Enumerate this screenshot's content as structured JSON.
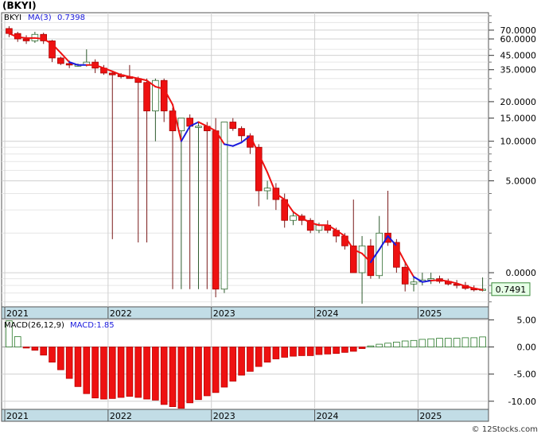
{
  "title": "(BKYI)",
  "watermark": "© 12Stocks.com",
  "colors": {
    "bullish": "#ffffff",
    "bearish": "#ee1111",
    "candle_outline": "#000000",
    "wick": "#7a1a1a",
    "ma_down": "#ee1111",
    "ma_up": "#1a1add",
    "axis_band": "#c2dde6",
    "grid": "#d0d0d0",
    "macd_pos": "#ffffff",
    "macd_pos_border": "#2a7a2a",
    "macd_neg": "#ee1111",
    "last_price_bg": "#e6ffe6",
    "last_price_border": "#3a8a3a"
  },
  "chart_data": [
    {
      "type": "candlestick",
      "title": "",
      "legend": {
        "ticker": "BKYI",
        "ma_label": "MA(3)",
        "ma_value": "0.7398",
        "placement": "top-left"
      },
      "y_scale": "log",
      "ylim": [
        0.55,
        95
      ],
      "y_ticks": [
        {
          "value": 70,
          "label": "70.0000"
        },
        {
          "value": 60,
          "label": "60.0000"
        },
        {
          "value": 45,
          "label": "45.0000"
        },
        {
          "value": 35,
          "label": "35.0000"
        },
        {
          "value": 20,
          "label": "20.0000"
        },
        {
          "value": 15,
          "label": "15.0000"
        },
        {
          "value": 10,
          "label": "10.0000"
        },
        {
          "value": 5,
          "label": "5.0000"
        },
        {
          "value": 1.0,
          "label": "0.0000"
        }
      ],
      "minor_grid": [
        90,
        80,
        50,
        40,
        30,
        25,
        9,
        8,
        7,
        6,
        4,
        3,
        2,
        0.9,
        0.8,
        0.7,
        0.6
      ],
      "last_price": {
        "value": 0.7491,
        "label": "0.7491"
      },
      "x_ticks": [
        {
          "index": 0,
          "label": "2021"
        },
        {
          "index": 12,
          "label": "2022"
        },
        {
          "index": 24,
          "label": "2023"
        },
        {
          "index": 36,
          "label": "2024"
        },
        {
          "index": 48,
          "label": "2025"
        }
      ],
      "candles": [
        [
          72,
          75,
          62,
          66
        ],
        [
          66,
          68,
          57,
          60
        ],
        [
          60,
          64,
          55,
          58
        ],
        [
          58,
          68,
          56,
          65
        ],
        [
          65,
          67,
          55,
          58
        ],
        [
          58,
          59,
          40,
          43
        ],
        [
          43,
          44,
          38,
          39
        ],
        [
          39,
          41,
          36,
          38
        ],
        [
          38,
          39,
          37,
          38
        ],
        [
          38,
          50,
          37,
          40
        ],
        [
          40,
          42,
          33,
          36
        ],
        [
          36,
          38,
          32,
          33
        ],
        [
          33,
          34,
          1.8,
          32
        ],
        [
          32,
          33,
          30,
          31
        ],
        [
          31,
          38,
          30,
          30
        ],
        [
          30,
          31,
          1.7,
          28
        ],
        [
          28,
          30,
          1.7,
          17
        ],
        [
          17,
          30,
          10,
          29
        ],
        [
          29,
          30,
          14,
          17
        ],
        [
          17,
          18,
          0.75,
          12
        ],
        [
          12,
          15,
          0.75,
          15
        ],
        [
          15,
          16,
          0.75,
          13
        ],
        [
          13,
          14,
          0.75,
          13
        ],
        [
          13,
          14,
          0.75,
          12
        ],
        [
          12,
          15,
          0.65,
          0.75
        ],
        [
          0.75,
          14,
          0.7,
          14
        ],
        [
          14,
          15,
          12,
          12.5
        ],
        [
          12.5,
          13,
          10,
          11
        ],
        [
          11,
          11.5,
          8,
          9
        ],
        [
          9,
          9.5,
          3.2,
          4.2
        ],
        [
          4.2,
          5,
          3.6,
          4.4
        ],
        [
          4.4,
          4.8,
          3,
          3.6
        ],
        [
          3.6,
          4,
          2.2,
          2.5
        ],
        [
          2.5,
          2.9,
          2.3,
          2.7
        ],
        [
          2.7,
          2.8,
          2.3,
          2.5
        ],
        [
          2.5,
          2.6,
          2.0,
          2.1
        ],
        [
          2.1,
          2.4,
          2.0,
          2.3
        ],
        [
          2.3,
          2.5,
          2.0,
          2.1
        ],
        [
          2.1,
          2.2,
          1.7,
          1.9
        ],
        [
          1.9,
          2.0,
          1.5,
          1.6
        ],
        [
          1.6,
          3.6,
          1.0,
          1.0
        ],
        [
          1.0,
          1.9,
          0.58,
          1.6
        ],
        [
          1.6,
          1.8,
          0.9,
          0.95
        ],
        [
          0.95,
          2.7,
          0.9,
          2.0
        ],
        [
          2.0,
          4.2,
          1.6,
          1.7
        ],
        [
          1.7,
          1.8,
          1.0,
          1.1
        ],
        [
          1.1,
          1.2,
          0.72,
          0.82
        ],
        [
          0.82,
          0.95,
          0.72,
          0.85
        ],
        [
          0.85,
          1.0,
          0.8,
          0.88
        ],
        [
          0.88,
          1.0,
          0.82,
          0.9
        ],
        [
          0.9,
          0.95,
          0.83,
          0.86
        ],
        [
          0.86,
          0.9,
          0.8,
          0.82
        ],
        [
          0.82,
          0.88,
          0.76,
          0.8
        ],
        [
          0.8,
          0.85,
          0.74,
          0.76
        ],
        [
          0.76,
          0.8,
          0.72,
          0.74
        ],
        [
          0.74,
          0.92,
          0.72,
          0.7491
        ]
      ],
      "ma": [
        66,
        62,
        61,
        61,
        60,
        55,
        47,
        40,
        38,
        38,
        38,
        36,
        34,
        32,
        31,
        30,
        29,
        26,
        25,
        19,
        10,
        13,
        14,
        13,
        12,
        9.5,
        9.2,
        9.8,
        11,
        8.0,
        5.8,
        4.0,
        3.6,
        2.9,
        2.6,
        2.4,
        2.3,
        2.3,
        2.1,
        1.9,
        1.5,
        1.4,
        1.2,
        1.5,
        1.9,
        1.6,
        1.2,
        0.93,
        0.85,
        0.87,
        0.88,
        0.86,
        0.83,
        0.79,
        0.76,
        0.7398
      ],
      "ma_color_flags": [
        0,
        0,
        0,
        0,
        0,
        0,
        0,
        0,
        1,
        1,
        0,
        0,
        0,
        0,
        0,
        0,
        0,
        0,
        0,
        0,
        0,
        1,
        1,
        0,
        0,
        0,
        1,
        1,
        1,
        0,
        0,
        0,
        0,
        0,
        0,
        0,
        0,
        0,
        0,
        0,
        0,
        0,
        0,
        1,
        1,
        1,
        0,
        0,
        1,
        1,
        0,
        0,
        0,
        0,
        0,
        0
      ]
    },
    {
      "type": "bar",
      "title": "",
      "legend": {
        "label": "MACD(26,12,9)",
        "value_label": "MACD:1.85",
        "placement": "top-left"
      },
      "ylim": [
        -11.5,
        5.2
      ],
      "y_ticks": [
        {
          "value": 5,
          "label": "5.00"
        },
        {
          "value": 0,
          "label": "0.00"
        },
        {
          "value": -5,
          "label": "-5.00"
        },
        {
          "value": -10,
          "label": "-10.00"
        }
      ],
      "x_ticks": [
        {
          "index": 0,
          "label": "2021"
        },
        {
          "index": 12,
          "label": "2022"
        },
        {
          "index": 24,
          "label": "2023"
        },
        {
          "index": 36,
          "label": "2024"
        },
        {
          "index": 48,
          "label": "2025"
        }
      ],
      "values": [
        4.8,
        1.9,
        -0.2,
        -0.6,
        -1.5,
        -2.8,
        -4.2,
        -5.8,
        -7.3,
        -8.6,
        -9.4,
        -9.6,
        -9.5,
        -9.3,
        -9.1,
        -9.3,
        -9.6,
        -9.8,
        -10.6,
        -11.0,
        -11.3,
        -10.3,
        -9.7,
        -9.0,
        -8.4,
        -7.4,
        -6.3,
        -5.2,
        -4.5,
        -3.6,
        -2.8,
        -2.2,
        -1.9,
        -1.7,
        -1.6,
        -1.6,
        -1.4,
        -1.3,
        -1.2,
        -1.0,
        -0.8,
        -0.3,
        0.2,
        0.5,
        0.7,
        0.9,
        1.1,
        1.2,
        1.4,
        1.5,
        1.6,
        1.6,
        1.6,
        1.7,
        1.7,
        1.85
      ]
    }
  ]
}
